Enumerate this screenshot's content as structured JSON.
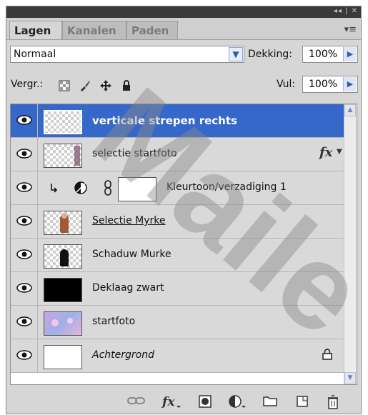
{
  "panel": {
    "title_controls": "◂◂ | ✕",
    "tabs": [
      {
        "label": "Lagen"
      },
      {
        "label": "Kanalen"
      },
      {
        "label": "Paden"
      }
    ],
    "menu_icon": "▾≡"
  },
  "blend": {
    "mode": "Normaal",
    "opacity_label": "Dekking:",
    "opacity_value": "100%",
    "lock_label": "Vergr.:",
    "fill_label": "Vul:",
    "fill_value": "100%"
  },
  "layers": [
    {
      "name": "verticale strepen rechts",
      "selected": true
    },
    {
      "name": "selectie startfoto",
      "fx": "fx"
    },
    {
      "name": "Kleurtoon/verzadiging 1"
    },
    {
      "name": "Selectie Myrke"
    },
    {
      "name": "Schaduw Murke"
    },
    {
      "name": "Deklaag zwart"
    },
    {
      "name": "startfoto"
    },
    {
      "name": "Achtergrond"
    }
  ],
  "watermark": "Maile",
  "colors": {
    "selected": "#3568c8",
    "panel_bg": "#d6d6d6",
    "accent": "#2d5db5"
  },
  "icons": [
    "eye-icon",
    "link-icon",
    "fx-icon",
    "mask-icon",
    "adjustment-icon",
    "folder-icon",
    "new-layer-icon",
    "trash-icon",
    "lock-icon"
  ]
}
